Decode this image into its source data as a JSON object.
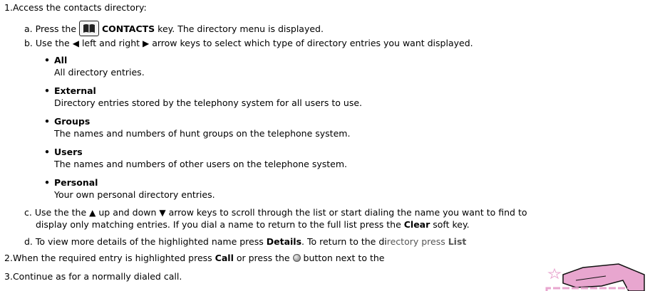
{
  "steps": [
    {
      "num": "1.",
      "text": "Access the contacts directory:"
    },
    {
      "num": "2.",
      "pre": "When the required entry is highlighted press ",
      "bold1": "Call",
      "mid": " or press the ",
      "post": " button next to the"
    },
    {
      "num": "3.",
      "text": "Continue as for a normally dialed call."
    }
  ],
  "substeps": {
    "a": {
      "letter": "a.",
      "pre": "Press the ",
      "key": "CONTACTS",
      "post": " key. The directory menu is displayed."
    },
    "b": {
      "letter": "b.",
      "pre": "Use the ",
      "mid1": " left and right ",
      "post": " arrow keys to select which type of directory entries you want displayed."
    },
    "c": {
      "letter": "c.",
      "pre": "Use the the ",
      "mid1": " up and down ",
      "post": " arrow keys to scroll through the list or start dialing the name you want to find to",
      "line2_pre": "display only matching entries. If you dial a name to return to the full list press the ",
      "line2_bold": "Clear",
      "line2_post": " soft key."
    },
    "d": {
      "letter": "d.",
      "pre": "To view more details of the highlighted name press ",
      "bold1": "Details",
      "mid": ". To return to the di",
      "tail": "rectory press ",
      "bold2": "List"
    }
  },
  "entries": [
    {
      "title": "All",
      "desc": "All directory entries."
    },
    {
      "title": "External",
      "desc": "Directory entries stored by the telephony system for all users to use."
    },
    {
      "title": "Groups",
      "desc": "The names and numbers of hunt groups on the telephone system."
    },
    {
      "title": "Users",
      "desc": "The names and numbers of other users on the telephone system."
    },
    {
      "title": "Personal",
      "desc": "Your own personal directory entries."
    }
  ],
  "icons": {
    "contacts_key": "book-icon",
    "left_arrow": "left-arrow-icon",
    "right_arrow": "right-arrow-icon",
    "up_arrow": "up-arrow-icon",
    "down_arrow": "down-arrow-icon",
    "button": "round-button-icon",
    "watermark": "pink-logo-watermark"
  },
  "colors": {
    "watermark_pink": "#e8a6cf",
    "watermark_outline": "#111111"
  }
}
